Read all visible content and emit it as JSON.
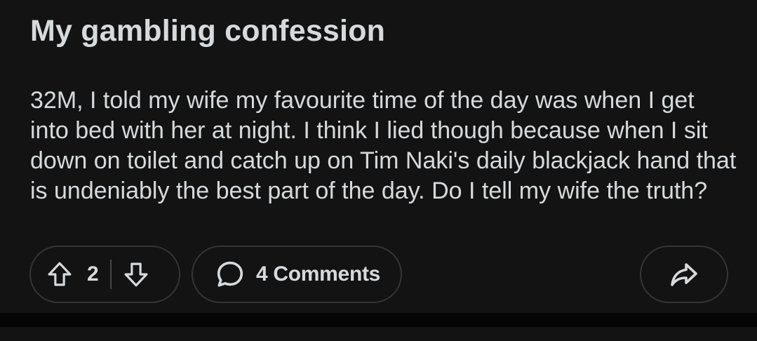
{
  "post": {
    "title": "My gambling confession",
    "body": "32M, I told my wife my favourite time of the day was when I get into bed with her at night. I think I lied though because when I sit down on toilet and catch up on Tim Naki's daily blackjack hand that is undeniably the best part of the day. Do I tell my wife the truth?"
  },
  "actions": {
    "vote_count": "2",
    "comments_label": "4 Comments",
    "icons": {
      "upvote": "arrow-up-icon",
      "downvote": "arrow-down-icon",
      "comments": "speech-bubble-icon",
      "share": "share-arrow-icon"
    }
  },
  "colors": {
    "background": "#131313",
    "text": "#d7dadc",
    "border": "#343536"
  }
}
